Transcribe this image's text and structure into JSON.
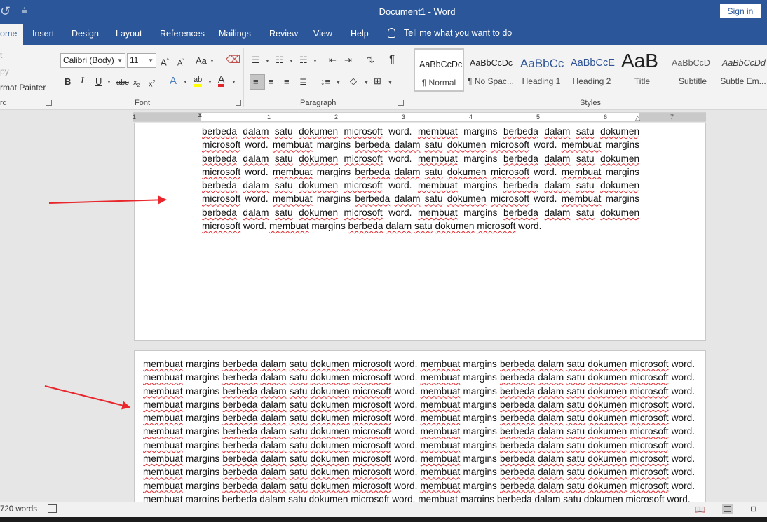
{
  "title_bar": {
    "document_title": "Document1  -  Word",
    "sign_in_label": "Sign in",
    "undo_icon": "undo-icon",
    "qat_icon": "customize-qat-icon"
  },
  "tabs": [
    {
      "label": "ome",
      "active": true
    },
    {
      "label": "Insert"
    },
    {
      "label": "Design"
    },
    {
      "label": "Layout"
    },
    {
      "label": "References"
    },
    {
      "label": "Mailings"
    },
    {
      "label": "Review"
    },
    {
      "label": "View"
    },
    {
      "label": "Help"
    }
  ],
  "tell_me": "Tell me what you want to do",
  "clipboard": {
    "cut": "t",
    "copy": "py",
    "format_painter": "rmat Painter",
    "group_label": "rd"
  },
  "font": {
    "font_name": "Calibri (Body)",
    "font_size": "11",
    "group_label": "Font"
  },
  "paragraph": {
    "group_label": "Paragraph"
  },
  "styles": {
    "group_label": "Styles",
    "items": [
      {
        "preview": "AaBbCcDc",
        "name": "¶ Normal",
        "selected": true
      },
      {
        "preview": "AaBbCcDc",
        "name": "¶ No Spac..."
      },
      {
        "preview": "AaBbCc",
        "name": "Heading 1",
        "color": "#2f5496"
      },
      {
        "preview": "AaBbCcE",
        "name": "Heading 2",
        "color": "#2f5496"
      },
      {
        "preview": "AaB",
        "name": "Title"
      },
      {
        "preview": "AaBbCcD",
        "name": "Subtitle",
        "color": "#5a5a5a"
      },
      {
        "preview": "AaBbCcDd",
        "name": "Subtle Em...",
        "color": "#404040"
      }
    ]
  },
  "ruler": {
    "numbers": [
      "1",
      "1",
      "2",
      "3",
      "4",
      "5",
      "6",
      "7"
    ]
  },
  "document": {
    "page1_text": "berbeda dalam satu dokumen microsoft word. membuat margins berbeda dalam satu dokumen microsoft word. membuat margins berbeda dalam satu dokumen microsoft word. membuat margins berbeda dalam satu dokumen microsoft word. membuat margins berbeda dalam satu dokumen microsoft word. membuat margins berbeda dalam satu dokumen microsoft word. membuat margins berbeda dalam satu dokumen microsoft word. membuat margins berbeda dalam satu dokumen microsoft word. membuat margins berbeda dalam satu dokumen microsoft word. membuat margins berbeda dalam satu dokumen microsoft word. membuat margins berbeda dalam satu dokumen microsoft word. membuat margins berbeda dalam satu dokumen microsoft word.",
    "page2_sentence": "membuat margins berbeda dalam satu dokumen microsoft word.",
    "page2_repeat": 22
  },
  "status_bar": {
    "word_count": "720 words"
  },
  "colors": {
    "accent": "#2b579a",
    "arrow": "#e8262b",
    "spell": "#e0272d"
  }
}
